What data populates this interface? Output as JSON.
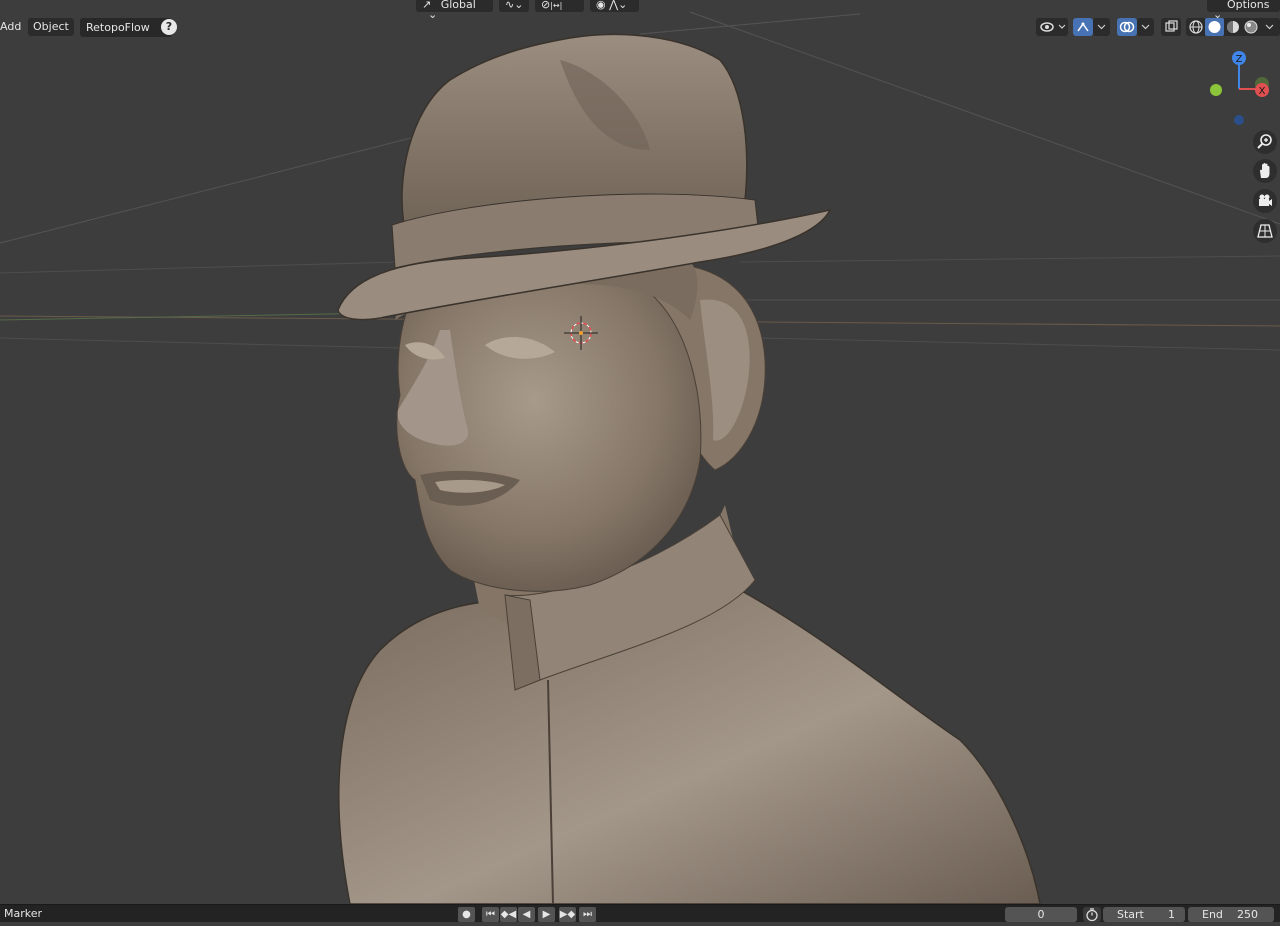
{
  "header": {
    "menu_add": "Add",
    "menu_object": "Object",
    "retopoflow_label": "RetopoFlow",
    "help_glyph": "?",
    "transform_orientation": "Global",
    "options_label": "Options",
    "snap_value": "|↔|"
  },
  "viewport": {
    "background_color": "#3d3d3d",
    "model_color": "#8b7d6e",
    "model_description_icon": "sculpted-bust-mesh",
    "gizmo": {
      "z": "Z",
      "x": "X"
    }
  },
  "timeline": {
    "marker_label": "Marker",
    "current_frame": "0",
    "start_label": "Start",
    "start_value": "1",
    "end_label": "End",
    "end_value": "250"
  },
  "colors": {
    "accent": "#4772b3",
    "axis_x": "#e05050",
    "axis_y": "#8ac53a",
    "axis_z": "#3f86e8"
  }
}
